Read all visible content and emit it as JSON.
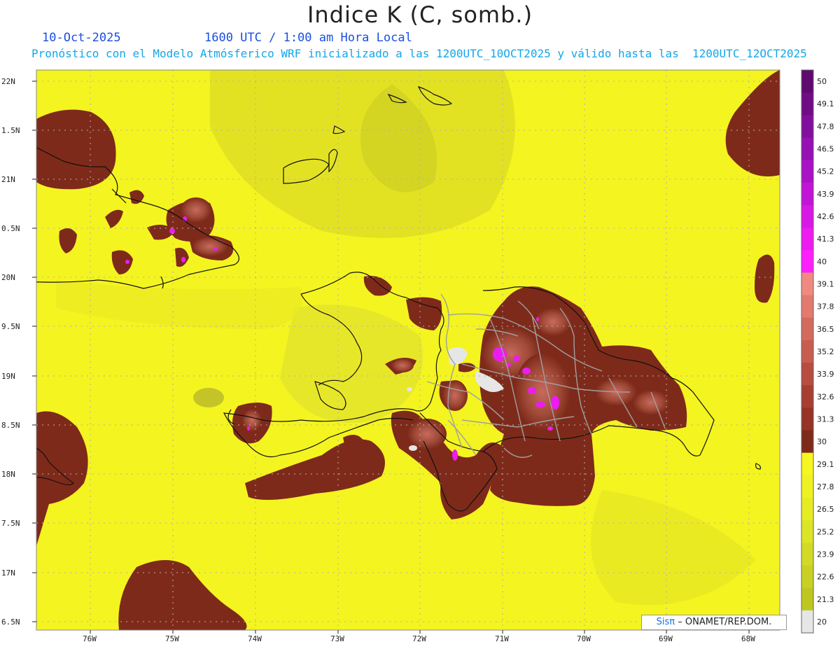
{
  "header": {
    "title": "Indice K (C, somb.)",
    "date": "10-Oct-2025",
    "time": "1600 UTC / 1:00 am Hora Local",
    "description": "Pronóstico con el Modelo Atmósferico WRF inicializado a las 1200UTC_10OCT2025 y válido hasta las  1200UTC_12OCT2025"
  },
  "axes": {
    "lat_labels": [
      "22N",
      "1.5N",
      "21N",
      "0.5N",
      "20N",
      "9.5N",
      "19N",
      "8.5N",
      "18N",
      "7.5N",
      "17N",
      "6.5N"
    ],
    "lon_labels": [
      "76W",
      "75W",
      "74W",
      "73W",
      "72W",
      "71W",
      "70W",
      "69W",
      "68W"
    ]
  },
  "colorbar": {
    "labels": [
      "50",
      "49.1",
      "47.8",
      "46.5",
      "45.2",
      "43.9",
      "42.6",
      "41.3",
      "40",
      "39.1",
      "37.8",
      "36.5",
      "35.2",
      "33.9",
      "32.6",
      "31.3",
      "30",
      "29.1",
      "27.8",
      "26.5",
      "25.2",
      "23.9",
      "22.6",
      "21.3",
      "20"
    ],
    "colors": [
      "#5e0a6e",
      "#6f0c86",
      "#820e9e",
      "#9610b4",
      "#aa12c6",
      "#c214d6",
      "#d818e4",
      "#ec1cf0",
      "#fc20fc",
      "#f08a80",
      "#e27a70",
      "#d46a5e",
      "#c85c50",
      "#b84c40",
      "#a83e32",
      "#963226",
      "#7e2a1a",
      "#f6f620",
      "#eef222",
      "#e6ec24",
      "#dce426",
      "#d2da26",
      "#c8d024",
      "#bec622",
      "#e6e6e6"
    ]
  },
  "credit": {
    "brand": "Sisπ",
    "org": "– ONAMET/REP.DOM."
  }
}
